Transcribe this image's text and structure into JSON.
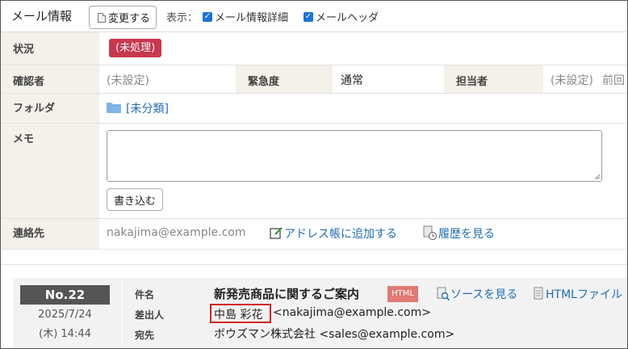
{
  "header": {
    "title": "メール情報",
    "change_button": "変更する",
    "display_label": "表示：",
    "checkbox_detail": "メール情報詳細",
    "checkbox_header": "メールヘッダ"
  },
  "status": {
    "label": "状況",
    "value": "(未処理)",
    "badge_color": "#c8374d"
  },
  "confirm": {
    "label": "確認者",
    "value": "(未設定)",
    "urgency_label": "緊急度",
    "urgency_value": "通常",
    "assignee_label": "担当者",
    "assignee_value": "(未設定)",
    "previous_label": "前回"
  },
  "folder": {
    "label": "フォルダ",
    "value": "[未分類]"
  },
  "memo": {
    "label": "メモ",
    "value": "",
    "button": "書き込む"
  },
  "contact": {
    "label": "連絡先",
    "email": "nakajima@example.com",
    "add_address": "アドレス帳に追加する",
    "history": "履歴を見る"
  },
  "mail": {
    "number": "No.22",
    "date": "2025/7/24",
    "time": "(木) 14:44",
    "subject_label": "件名",
    "subject": "新発売商品に関するご案内",
    "html_badge": "HTML",
    "view_source": "ソースを見る",
    "html_file": "HTMLファイル",
    "from_label": "差出人",
    "from_name": "中島 彩花",
    "from_email": "<nakajima@example.com>",
    "to_label": "宛先",
    "to": "ボウズマン株式会社 <sales@example.com>"
  }
}
